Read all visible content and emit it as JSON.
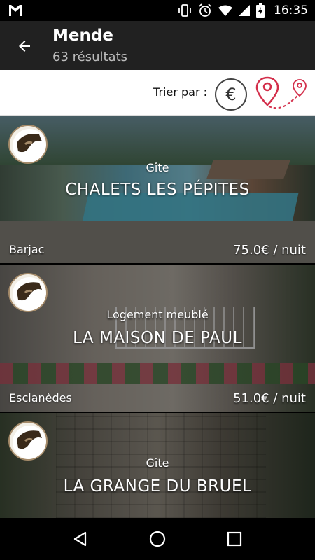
{
  "status_bar": {
    "time": "16:35",
    "icons": [
      "gmail-icon",
      "vibrate-icon",
      "alarm-icon",
      "wifi-icon",
      "signal-icon",
      "battery-charging-icon"
    ]
  },
  "app_bar": {
    "title": "Mende",
    "subtitle": "63 résultats",
    "back_icon": "arrow-back-icon"
  },
  "sort_bar": {
    "label": "Trier par :",
    "price_symbol": "€",
    "options": [
      "price-sort-icon",
      "distance-sort-icon"
    ]
  },
  "listings": [
    {
      "type": "Gîte",
      "name": "CHALETS LES PÉPITES",
      "town": "Barjac",
      "price": "75.0€ / nuit"
    },
    {
      "type": "Logement meublé",
      "name": "LA MAISON DE PAUL",
      "town": "Esclanèdes",
      "price": "51.0€ / nuit"
    },
    {
      "type": "Gîte",
      "name": "LA GRANGE DU BRUEL",
      "town": "",
      "price": ""
    }
  ],
  "nav_bar": {
    "buttons": [
      "back-triangle-icon",
      "home-circle-icon",
      "recents-square-icon"
    ]
  },
  "colors": {
    "accent": "#d32f4b",
    "app_bar": "#212121",
    "badge_border": "#a58b6a"
  }
}
